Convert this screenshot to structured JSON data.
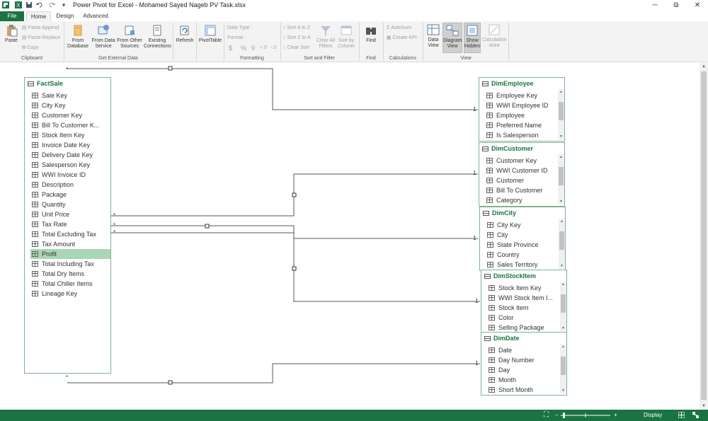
{
  "window": {
    "title": "Power Pivot for Excel - Mohamed Sayed Nageb PV Task.xlsx",
    "quick_access": {
      "customize": "▾"
    },
    "controls": {
      "minimize": "─",
      "restore": "⧉",
      "close": "✕"
    }
  },
  "tabs": [
    {
      "label": "File"
    },
    {
      "label": "Home"
    },
    {
      "label": "Design"
    },
    {
      "label": "Advanced"
    }
  ],
  "ribbon": {
    "clipboard": {
      "paste": "Paste",
      "paste_append": "Paste Append",
      "paste_replace": "Paste Replace",
      "copy": "Copy",
      "group_label": "Clipboard"
    },
    "external_data": {
      "from_database": "From Database",
      "from_data_service": "From Data Service",
      "from_other_sources": "From Other Sources",
      "existing_connections": "Existing Connections",
      "group_label": "Get External Data"
    },
    "refresh": "Refresh",
    "pivottable": "PivotTable",
    "formatting": {
      "data_type": "Data Type :",
      "format": "Format :",
      "currency": "$",
      "percent": "%",
      "comma": "9",
      "inc_decimal": "+.0",
      "dec_decimal": "-.0",
      "group_label": "Formatting"
    },
    "sort_filter": {
      "sort_a_to_z": "Sort A to Z",
      "sort_z_to_a": "Sort Z to A",
      "clear_sort": "Clear Sort",
      "clear_all_filters": "Clear All Filters",
      "sort_by_column": "Sort by Column",
      "group_label": "Sort and Filter"
    },
    "find": {
      "label": "Find",
      "group_label": "Find"
    },
    "calculations": {
      "autosum": "AutoSum",
      "create_kpi": "Create KPI",
      "group_label": "Calculations"
    },
    "view": {
      "data_view": "Data View",
      "diagram_view": "Diagram View",
      "show_hidden": "Show Hidden",
      "calculation_area": "Calculation Area",
      "group_label": "View"
    }
  },
  "diagram": {
    "fact_table": {
      "name": "FactSale",
      "columns": [
        "Sale Key",
        "City Key",
        "Customer Key",
        "Bill To Customer K...",
        "Stock Item Key",
        "Invoice Date Key",
        "Delivery Date Key",
        "Salesperson Key",
        "WWI Invoice ID",
        "Description",
        "Package",
        "Quantity",
        "Unit Price",
        "Tax Rate",
        "Total Excluding Tax",
        "Tax Amount",
        "Profit",
        "Total Including Tax",
        "Total Dry Items",
        "Total Chiller Items",
        "Lineage Key"
      ],
      "selected": "Profit"
    },
    "dim_tables": [
      {
        "name": "DimEmployee",
        "columns": [
          "Employee Key",
          "WWI Employee ID",
          "Employee",
          "Preferred Name",
          "Is Salesperson"
        ]
      },
      {
        "name": "DimCustomer",
        "columns": [
          "Customer Key",
          "WWI Customer ID",
          "Customer",
          "Bill To Customer",
          "Category"
        ]
      },
      {
        "name": "DimCity",
        "columns": [
          "City Key",
          "City",
          "State Province",
          "Country",
          "Sales Territory"
        ]
      },
      {
        "name": "DimStockItem",
        "columns": [
          "Stock Item Key",
          "WWI Stock Item I...",
          "Stock Item",
          "Color",
          "Selling Package"
        ]
      },
      {
        "name": "DimDate",
        "columns": [
          "Date",
          "Day Number",
          "Day",
          "Month",
          "Short Month"
        ]
      }
    ],
    "many_marker": "*",
    "one_marker": "1"
  },
  "status": {
    "display": "Display",
    "zoom_minus": "−",
    "zoom_plus": "+"
  },
  "colors": {
    "accent": "#1a7343",
    "selected_row": "#a9d6b5",
    "table_border": "#7fb38f"
  }
}
